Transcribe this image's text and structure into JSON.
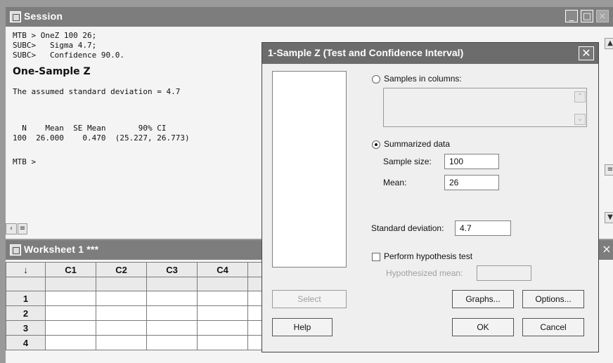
{
  "session": {
    "title": "Session",
    "lines": [
      "MTB > OneZ 100 26;",
      "SUBC>   Sigma 4.7;",
      "SUBC>   Confidence 90.0."
    ],
    "heading": "One-Sample Z",
    "assumed": "The assumed standard deviation = 4.7",
    "table_header": "  N    Mean  SE Mean       90% CI",
    "table_row": "100  26.000    0.470  (25.227, 26.773)",
    "prompt": "MTB >"
  },
  "worksheet": {
    "title": "Worksheet 1 ***",
    "corner": "↓",
    "columns": [
      "C1",
      "C2",
      "C3",
      "C4"
    ],
    "rows": [
      "1",
      "2",
      "3",
      "4"
    ]
  },
  "dialog": {
    "title": "1-Sample Z (Test and Confidence Interval)",
    "samples_in_columns": "Samples in columns:",
    "summarized_data": "Summarized data",
    "sample_size_label": "Sample size:",
    "sample_size_value": "100",
    "mean_label": "Mean:",
    "mean_value": "26",
    "std_dev_label": "Standard deviation:",
    "std_dev_value": "4.7",
    "perform_test": "Perform hypothesis test",
    "hyp_mean_label": "Hypothesized mean:",
    "hyp_mean_value": "",
    "buttons": {
      "select": "Select",
      "graphs": "Graphs...",
      "options": "Options...",
      "help": "Help",
      "ok": "OK",
      "cancel": "Cancel"
    }
  }
}
